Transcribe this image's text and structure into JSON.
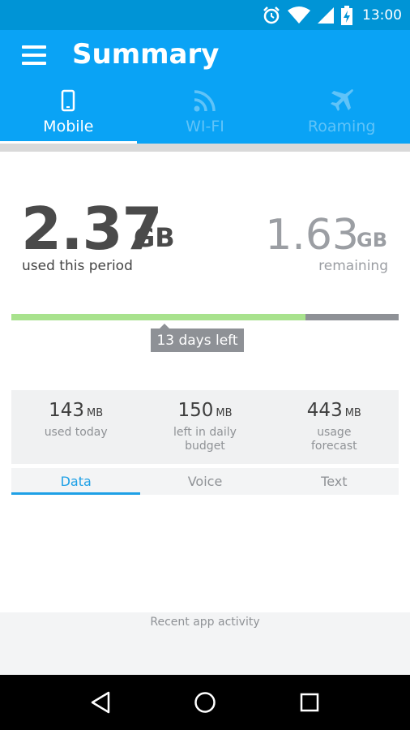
{
  "status_bar": {
    "time": "13:00",
    "icons": [
      "alarm-icon",
      "wifi-icon",
      "signal-icon",
      "battery-charging-icon"
    ]
  },
  "app_bar": {
    "title": "Summary",
    "menu_icon": "hamburger-menu-icon"
  },
  "tabs": [
    {
      "label": "Mobile",
      "icon": "phone-icon",
      "active": true
    },
    {
      "label": "WI-FI",
      "icon": "wifi-rss-icon",
      "active": false
    },
    {
      "label": "Roaming",
      "icon": "airplane-icon",
      "active": false
    }
  ],
  "usage": {
    "used_value": "2.37",
    "used_unit": "GB",
    "used_caption": "used this period",
    "remaining_value": "1.63",
    "remaining_unit": "GB",
    "remaining_caption": "remaining",
    "progress_fraction": 0.76,
    "days_left": "13 days left"
  },
  "stats": [
    {
      "value": "143",
      "unit": "MB",
      "label": "used today"
    },
    {
      "value": "150",
      "unit": "MB",
      "label": "left in daily budget"
    },
    {
      "value": "443",
      "unit": "MB",
      "label": "usage forecast"
    }
  ],
  "subtabs": [
    {
      "label": "Data",
      "active": true
    },
    {
      "label": "Voice",
      "active": false
    },
    {
      "label": "Text",
      "active": false
    }
  ],
  "recent": {
    "label": "Recent app activity"
  },
  "nav_bar": {
    "icons": [
      "back-icon",
      "home-icon",
      "recents-icon"
    ]
  },
  "colors": {
    "status_bar": "#0094d6",
    "app_bar": "#0aa3f5",
    "progress_used": "#a8e28d",
    "progress_remaining": "#8e9196",
    "accent": "#1ea0e6"
  }
}
